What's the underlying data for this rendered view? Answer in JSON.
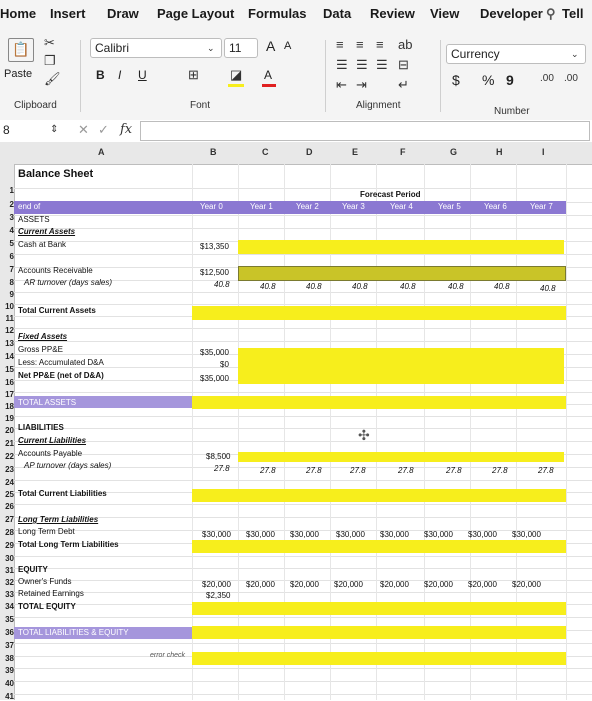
{
  "ribbon_tabs": [
    "Home",
    "Insert",
    "Draw",
    "Page Layout",
    "Formulas",
    "Data",
    "Review",
    "View",
    "Developer"
  ],
  "tell_me": "Tell",
  "clipboard": {
    "paste_label": "Paste",
    "group_label": "Clipboard"
  },
  "font": {
    "family": "Calibri",
    "size": "11",
    "grow": "A",
    "shrink": "A",
    "bold": "B",
    "italic": "I",
    "underline": "U",
    "group_label": "Font"
  },
  "alignment": {
    "group_label": "Alignment"
  },
  "number": {
    "format": "Currency",
    "currency_symbol": "$",
    "percent": "%",
    "comma": "9",
    "group_label": "Number"
  },
  "formula_bar": {
    "name_box": "8",
    "fx": "fx",
    "cancel": "✕",
    "enter": "✓"
  },
  "colors": {
    "highlight": "#f7ee1c",
    "header_purple": "#8b78d2",
    "subheader_purple": "#a596dc"
  },
  "columns": [
    "A",
    "B",
    "C",
    "D",
    "E",
    "F",
    "G",
    "H",
    "I"
  ],
  "rows": [
    "1",
    "2",
    "3",
    "4",
    "5",
    "6",
    "7",
    "8",
    "9",
    "10",
    "11",
    "12",
    "13",
    "14",
    "15",
    "16",
    "17",
    "18",
    "19",
    "20",
    "21",
    "22",
    "23",
    "24",
    "25",
    "26",
    "27",
    "28",
    "29",
    "30",
    "31",
    "32",
    "33",
    "34",
    "35",
    "36",
    "37",
    "38",
    "39",
    "40",
    "41"
  ],
  "sheet": {
    "title": "Balance Sheet",
    "forecast_period": "Forecast Period",
    "header": {
      "col_a": "end of",
      "years": [
        "Year 0",
        "Year 1",
        "Year 2",
        "Year 3",
        "Year 4",
        "Year 5",
        "Year 6",
        "Year 7"
      ]
    },
    "labels": {
      "assets": "ASSETS",
      "current_assets": "Current Assets",
      "cash": "Cash at Bank",
      "ar": "Accounts Receivable",
      "ar_turnover": "AR turnover (days sales)",
      "total_current_assets": "Total Current Assets",
      "fixed_assets": "Fixed Assets",
      "gross_ppe": "Gross PP&E",
      "less_dep": "Less: Accumulated D&A",
      "net_ppe": "Net PP&E (net of D&A)",
      "total_assets": "TOTAL ASSETS",
      "liabilities": "LIABILITIES",
      "current_liabilities": "Current Liabilities",
      "ap": "Accounts Payable",
      "ap_turnover": "AP turnover (days sales)",
      "total_current_liabilities": "Total Current Liabilities",
      "long_term_liabilities": "Long Term Liabilities",
      "lt_debt": "Long Term Debt",
      "total_lt_liabilities": "Total Long Term Liabilities",
      "equity": "EQUITY",
      "owners_funds": "Owner's Funds",
      "retained": "Retained Earnings",
      "total_equity": "TOTAL EQUITY",
      "total_le": "TOTAL LIABILITIES & EQUITY",
      "error_check": "error check"
    },
    "values": {
      "cash_y0": "$13,350",
      "ar_y0": "$12,500",
      "ar_turnover": [
        "40.8",
        "40.8",
        "40.8",
        "40.8",
        "40.8",
        "40.8",
        "40.8",
        "40.8"
      ],
      "gross_ppe_y0": "$35,000",
      "dep_y0": "$0",
      "net_ppe_y0": "$35,000",
      "ap_y0": "$8,500",
      "ap_turnover": [
        "27.8",
        "27.8",
        "27.8",
        "27.8",
        "27.8",
        "27.8",
        "27.8",
        "27.8"
      ],
      "lt_debt": [
        "$30,000",
        "$30,000",
        "$30,000",
        "$30,000",
        "$30,000",
        "$30,000",
        "$30,000",
        "$30,000"
      ],
      "owners_funds": [
        "$20,000",
        "$20,000",
        "$20,000",
        "$20,000",
        "$20,000",
        "$20,000",
        "$20,000",
        "$20,000"
      ],
      "retained_y0": "$2,350"
    }
  }
}
